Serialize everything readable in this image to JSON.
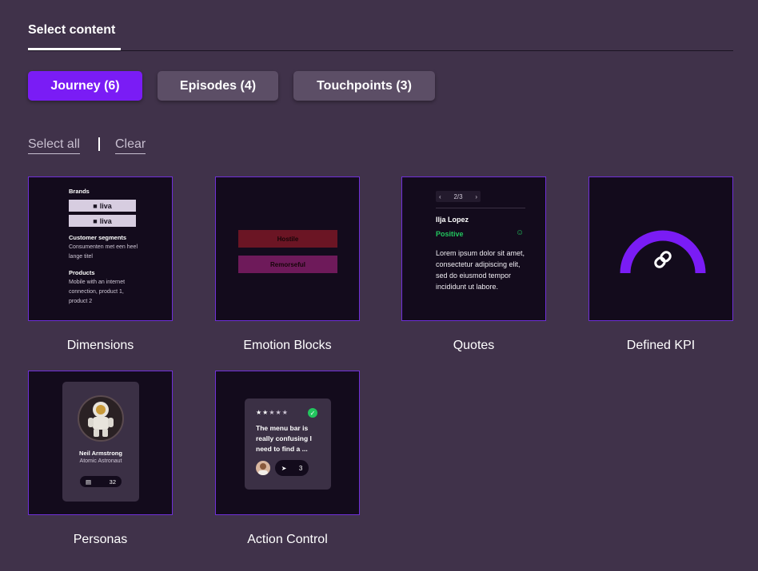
{
  "tabs": {
    "active_label": "Select content"
  },
  "filters": [
    {
      "label": "Journey (6)"
    },
    {
      "label": "Episodes (4)"
    },
    {
      "label": "Touchpoints (3)"
    }
  ],
  "actions": {
    "select_all": "Select all",
    "clear": "Clear"
  },
  "colors": {
    "accent": "#7a1cf5",
    "background": "#40324a",
    "card_bg": "#130b1c",
    "positive": "#22c55e"
  },
  "cards": {
    "dimensions": {
      "label": "Dimensions",
      "brands_heading": "Brands",
      "brand_names": [
        "liva",
        "liva"
      ],
      "segments_heading": "Customer segments",
      "segments_text": "Consumenten met een heel lange titel",
      "products_heading": "Products",
      "products_text": "Mobile with an internet connection, product 1, product 2"
    },
    "emotion": {
      "label": "Emotion Blocks",
      "blocks": [
        "Hostile",
        "Remorseful"
      ]
    },
    "quotes": {
      "label": "Quotes",
      "pager": "2/3",
      "name": "Ilja Lopez",
      "sentiment": "Positive",
      "text": "Lorem ipsum dolor sit amet, consectetur adipiscing elit, sed do eiusmod tempor incididunt ut labore."
    },
    "kpi": {
      "label": "Defined KPI",
      "icon": "link-icon"
    },
    "personas": {
      "label": "Personas",
      "name": "Neil Armstrong",
      "role": "Atomic Astronaut",
      "count": "32"
    },
    "action": {
      "label": "Action Control",
      "rating": 2,
      "stars_total": 5,
      "text": "The menu bar is really confusing I need to find a ...",
      "count": "3"
    }
  }
}
